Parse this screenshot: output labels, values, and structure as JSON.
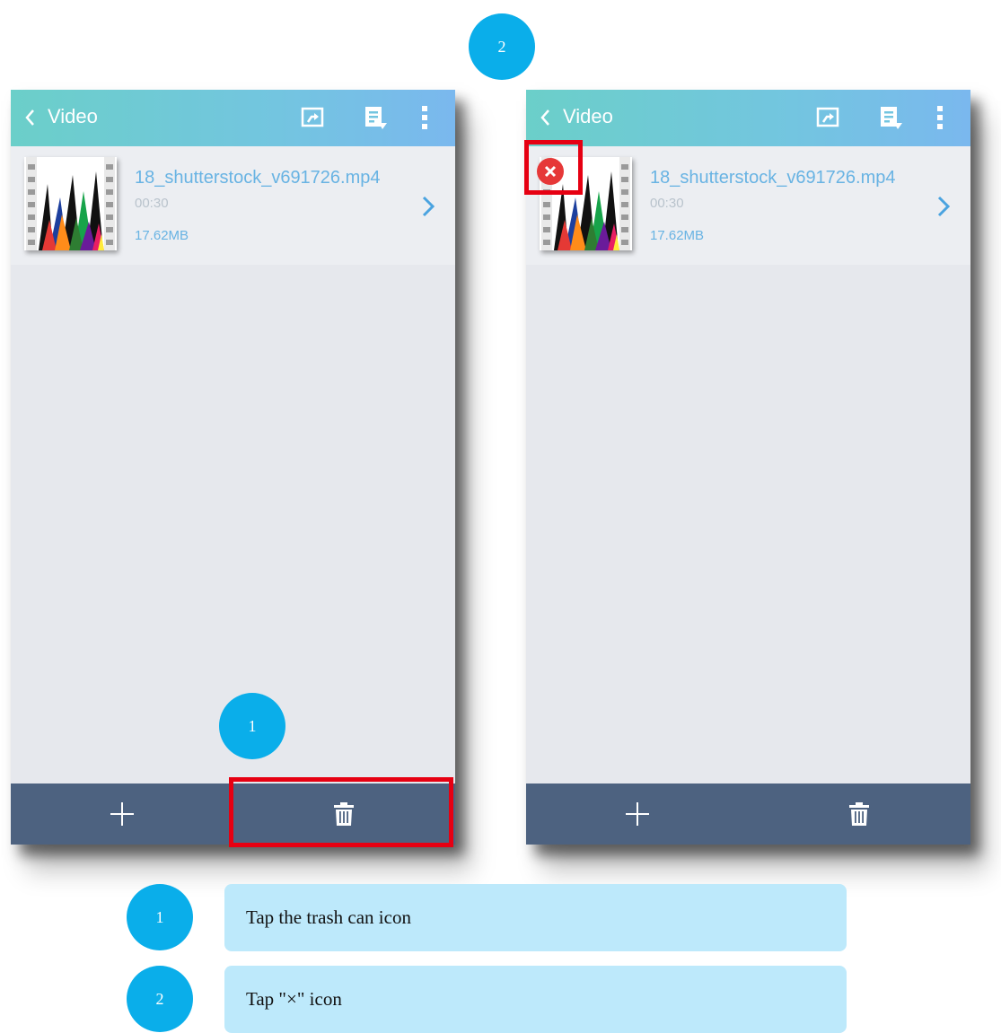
{
  "steps_top": {
    "step2_label": "2"
  },
  "screens": [
    {
      "title": "Video",
      "file": {
        "name": "18_shutterstock_v691726.mp4",
        "duration": "00:30",
        "size": "17.62MB"
      },
      "step_badge": "1"
    },
    {
      "title": "Video",
      "file": {
        "name": "18_shutterstock_v691726.mp4",
        "duration": "00:30",
        "size": "17.62MB"
      }
    }
  ],
  "icons": {
    "back": "chevron-left-icon",
    "cast": "screen-share-icon",
    "note": "note-edit-icon",
    "menu": "more-vertical-icon",
    "add": "plus-icon",
    "delete": "trash-icon",
    "remove": "close-circle-icon",
    "open": "chevron-right-icon"
  },
  "instructions": [
    {
      "number": "1",
      "text": "Tap the trash can icon"
    },
    {
      "number": "2",
      "text": "Tap \"×\" icon"
    }
  ],
  "colors": {
    "accent_blue": "#0aaeea",
    "highlight_red": "#e60012",
    "bottom_bar": "#4d6280",
    "instruction_bg": "#bde9fb"
  }
}
